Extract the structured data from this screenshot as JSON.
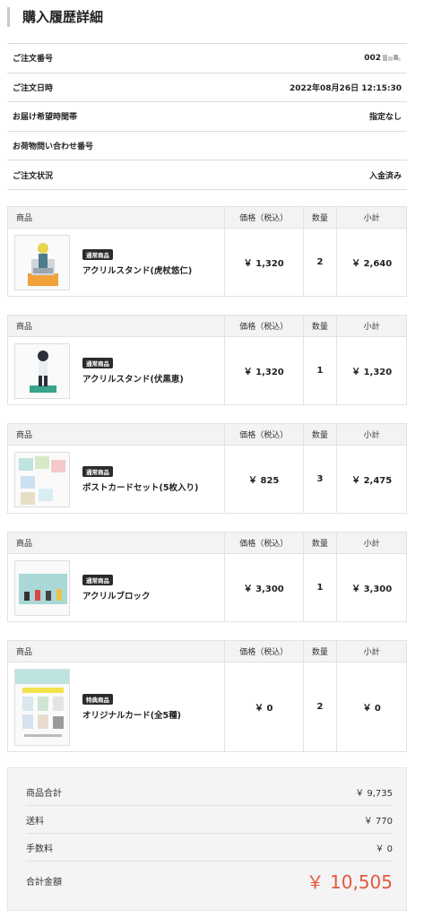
{
  "page": {
    "title": "購入履歴詳細"
  },
  "order_info": [
    {
      "label": "ご注文番号",
      "value": "002"
    },
    {
      "label": "ご注文日時",
      "value": "2022年08月26日 12:15:30"
    },
    {
      "label": "お届け希望時間帯",
      "value": "指定なし"
    },
    {
      "label": "お荷物問い合わせ番号",
      "value": ""
    },
    {
      "label": "ご注文状況",
      "value": "入金済み"
    }
  ],
  "columns": {
    "product": "商品",
    "price": "価格（税込）",
    "qty": "数量",
    "subtotal": "小計"
  },
  "items": [
    {
      "badge": "通常商品",
      "name": "アクリルスタンド(虎杖悠仁)",
      "price": "￥ 1,320",
      "qty": "2",
      "subtotal": "￥ 2,640",
      "thumb": "acrylic-stand-figure"
    },
    {
      "badge": "通常商品",
      "name": "アクリルスタンド(伏黒恵)",
      "price": "￥ 1,320",
      "qty": "1",
      "subtotal": "￥ 1,320",
      "thumb": "acrylic-stand-figure"
    },
    {
      "badge": "通常商品",
      "name": "ポストカードセット(5枚入り)",
      "price": "￥ 825",
      "qty": "3",
      "subtotal": "￥ 2,475",
      "thumb": "postcard-set"
    },
    {
      "badge": "通常商品",
      "name": "アクリルブロック",
      "price": "￥ 3,300",
      "qty": "1",
      "subtotal": "￥ 3,300",
      "thumb": "acrylic-block"
    },
    {
      "badge": "特典商品",
      "name": "オリジナルカード(全5種)",
      "price": "￥ 0",
      "qty": "2",
      "subtotal": "￥ 0",
      "thumb": "original-card-sheet"
    }
  ],
  "summary": {
    "items_total_label": "商品合計",
    "items_total": "￥ 9,735",
    "shipping_label": "送料",
    "shipping": "￥ 770",
    "fee_label": "手数料",
    "fee": "￥ 0",
    "grand_total_label": "合計金額",
    "grand_total": "￥ 10,505"
  },
  "colors": {
    "accent_total": "#e25a3f",
    "badge_bg": "#2b2b2b",
    "header_bg": "#f3f3f3"
  }
}
